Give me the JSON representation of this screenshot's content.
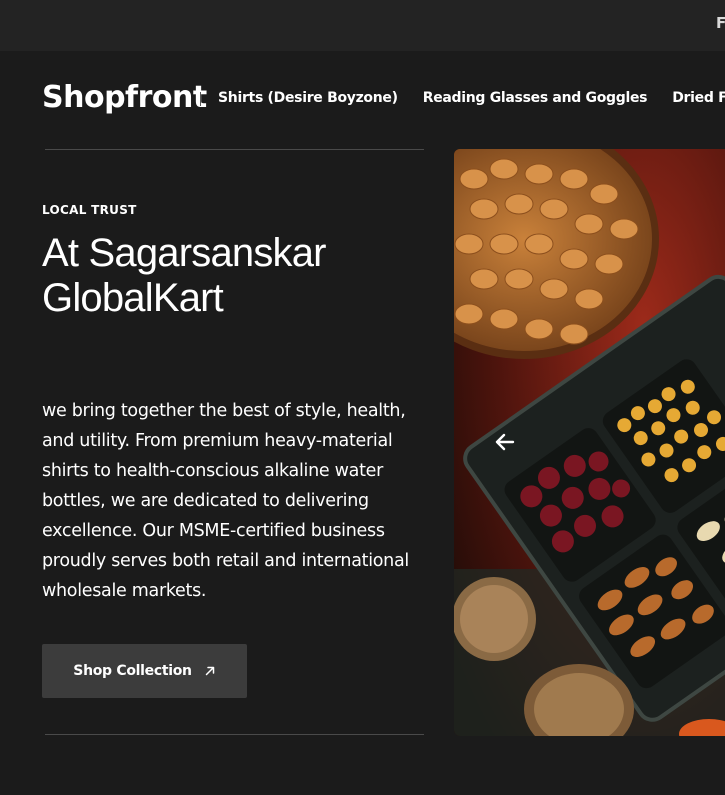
{
  "topbar": {
    "text": "F"
  },
  "header": {
    "logo": "Shopfront",
    "nav": [
      {
        "label": "Shirts (Desire Boyzone)"
      },
      {
        "label": "Reading Glasses and Goggles"
      },
      {
        "label": "Dried Fruit"
      }
    ]
  },
  "hero": {
    "eyebrow": "LOCAL TRUST",
    "title": "At Sagarsanskar GlobalKart",
    "body": "we bring together the best of style, health, and utility. From premium heavy-material shirts to health-conscious alkaline water bottles, we are dedicated to delivering excellence. Our MSME-certified business proudly serves both retail and international wholesale markets.",
    "cta_label": "Shop Collection",
    "cta_icon": "arrow-up-right-icon",
    "slider_icon": "arrow-left-icon",
    "image_subject": "dried fruits and nuts in a tray"
  },
  "colors": {
    "background": "#1b1b1b",
    "topbar": "#232323",
    "button": "#3c3c3c",
    "rule": "#4a4a4a"
  }
}
